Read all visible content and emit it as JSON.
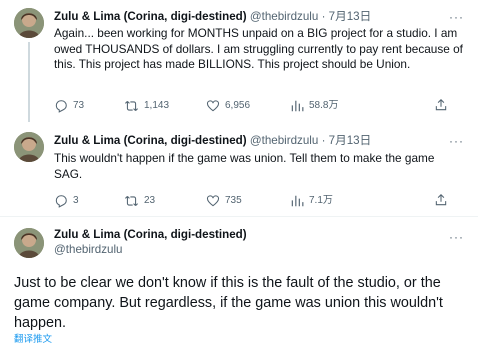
{
  "tweets": [
    {
      "name": "Zulu & Lima (Corina, digi-destined)",
      "handle": "@thebirdzulu",
      "separator": "·",
      "date": "7月13日",
      "text": "Again... been working for MONTHS unpaid on a BIG project for a studio. I am owed THOUSANDS of dollars. I am struggling currently to pay rent because of this. This project has made BILLIONS. This project should be Union.",
      "replies": "73",
      "retweets": "1,143",
      "likes": "6,956",
      "views": "58.8万"
    },
    {
      "name": "Zulu & Lima (Corina, digi-destined)",
      "handle": "@thebirdzulu",
      "separator": "·",
      "date": "7月13日",
      "text": "This wouldn't happen if the game was union. Tell them to make the game SAG.",
      "replies": "3",
      "retweets": "23",
      "likes": "735",
      "views": "7.1万"
    },
    {
      "name": "Zulu & Lima (Corina, digi-destined)",
      "handle": "@thebirdzulu",
      "text": "Just to be clear we don't know if this is the fault of the studio, or the game company. But regardless, if the game was union this wouldn't happen.",
      "translate": "翻译推文"
    }
  ],
  "more_label": "···"
}
